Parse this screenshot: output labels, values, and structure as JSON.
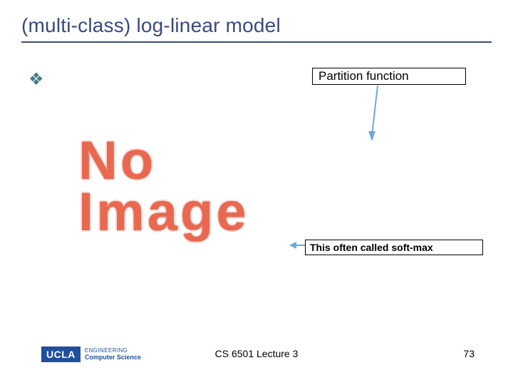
{
  "slide": {
    "title": "(multi-class) log-linear model",
    "bullet_glyph": "❖",
    "annotations": {
      "partition": "Partition  function",
      "softmax": "This often called soft-max"
    },
    "placeholder": {
      "line1": "No",
      "line2": "Image"
    },
    "logo": {
      "brand": "UCLA",
      "line1": "ENGINEERING",
      "line2": "Computer Science"
    },
    "footer_center": "CS 6501 Lecture 3",
    "page_number": "73"
  }
}
